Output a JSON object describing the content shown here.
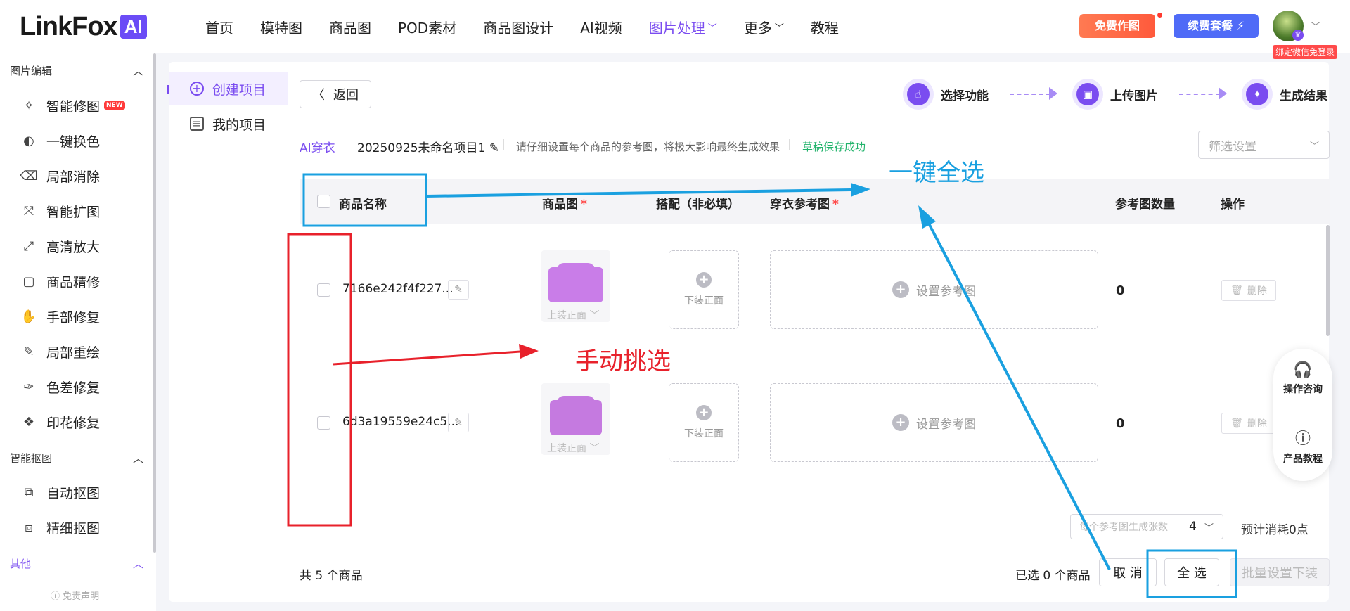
{
  "header": {
    "logo_text": "LinkFox",
    "logo_badge": "AI",
    "nav": [
      {
        "label": "首页",
        "dropdown": false,
        "active": false
      },
      {
        "label": "模特图",
        "dropdown": false,
        "active": false
      },
      {
        "label": "商品图",
        "dropdown": false,
        "active": false
      },
      {
        "label": "POD素材",
        "dropdown": false,
        "active": false
      },
      {
        "label": "商品图设计",
        "dropdown": false,
        "active": false
      },
      {
        "label": "AI视频",
        "dropdown": false,
        "active": false
      },
      {
        "label": "图片处理",
        "dropdown": true,
        "active": true
      },
      {
        "label": "更多",
        "dropdown": true,
        "active": false
      },
      {
        "label": "教程",
        "dropdown": false,
        "active": false
      }
    ],
    "free_btn": "免费作图",
    "renew_btn": "续费套餐",
    "renew_icon": "⚡",
    "wx_login": "绑定微信免登录"
  },
  "sidebar": {
    "sections": [
      {
        "title": "图片编辑",
        "items": [
          {
            "label": "智能修图",
            "icon": "wand-icon",
            "glyph": "✧",
            "badge": "NEW"
          },
          {
            "label": "一键换色",
            "icon": "color-swap-icon",
            "glyph": "◐"
          },
          {
            "label": "局部消除",
            "icon": "eraser-icon",
            "glyph": "⌫"
          },
          {
            "label": "智能扩图",
            "icon": "expand-icon",
            "glyph": "⤧"
          },
          {
            "label": "高清放大",
            "icon": "upscale-icon",
            "glyph": "⤢"
          },
          {
            "label": "商品精修",
            "icon": "retouch-icon",
            "glyph": "▢"
          },
          {
            "label": "手部修复",
            "icon": "hand-icon",
            "glyph": "✋"
          },
          {
            "label": "局部重绘",
            "icon": "repaint-icon",
            "glyph": "✎"
          },
          {
            "label": "色差修复",
            "icon": "color-fix-icon",
            "glyph": "✑"
          },
          {
            "label": "印花修复",
            "icon": "pattern-icon",
            "glyph": "❖"
          }
        ]
      },
      {
        "title": "智能抠图",
        "items": [
          {
            "label": "自动抠图",
            "icon": "auto-cutout-icon",
            "glyph": "⧉"
          },
          {
            "label": "精细抠图",
            "icon": "fine-cutout-icon",
            "glyph": "⧈"
          }
        ]
      },
      {
        "title": "其他",
        "items": []
      }
    ],
    "footer": "免责声明"
  },
  "projects": {
    "create": "创建项目",
    "mine": "我的项目"
  },
  "toolbar": {
    "back": "返回",
    "steps": [
      "选择功能",
      "上传图片",
      "生成结果"
    ]
  },
  "breadcrumb": {
    "tag": "AI穿衣",
    "project_name": "20250925未命名项目1",
    "tip": "请仔细设置每个商品的参考图，将极大影响最终生成效果",
    "saved": "草稿保存成功"
  },
  "filter": {
    "placeholder": "筛选设置"
  },
  "table": {
    "columns": {
      "name": "商品名称",
      "image": "商品图",
      "match": "搭配（非必填）",
      "ref": "穿衣参考图",
      "ref_count": "参考图数量",
      "action": "操作"
    },
    "rows": [
      {
        "name": "7166e242f4f227...",
        "image_label": "上装正面",
        "match_label": "下装正面",
        "ref_label": "设置参考图",
        "count": "0",
        "delete": "删除"
      },
      {
        "name": "6d3a19559e24c5...",
        "image_label": "上装正面",
        "match_label": "下装正面",
        "ref_label": "设置参考图",
        "count": "0",
        "delete": "删除"
      }
    ]
  },
  "float_panel": {
    "consult": "操作咨询",
    "tutorial": "产品教程"
  },
  "footer": {
    "gen_label": "每个参考图生成张数",
    "gen_value": "4",
    "cost": "预计消耗0点",
    "total": "共 5 个商品",
    "selected": "已选 0 个商品",
    "cancel": "取 消",
    "select_all": "全 选",
    "batch": "批量设置下装"
  },
  "annotations": {
    "select_all_note": "一键全选",
    "manual_note": "手动挑选"
  },
  "colors": {
    "accent": "#7a4cf0",
    "annotation_blue": "#1aa0e0",
    "annotation_red": "#e8212b",
    "saved_green": "#21b36b"
  }
}
